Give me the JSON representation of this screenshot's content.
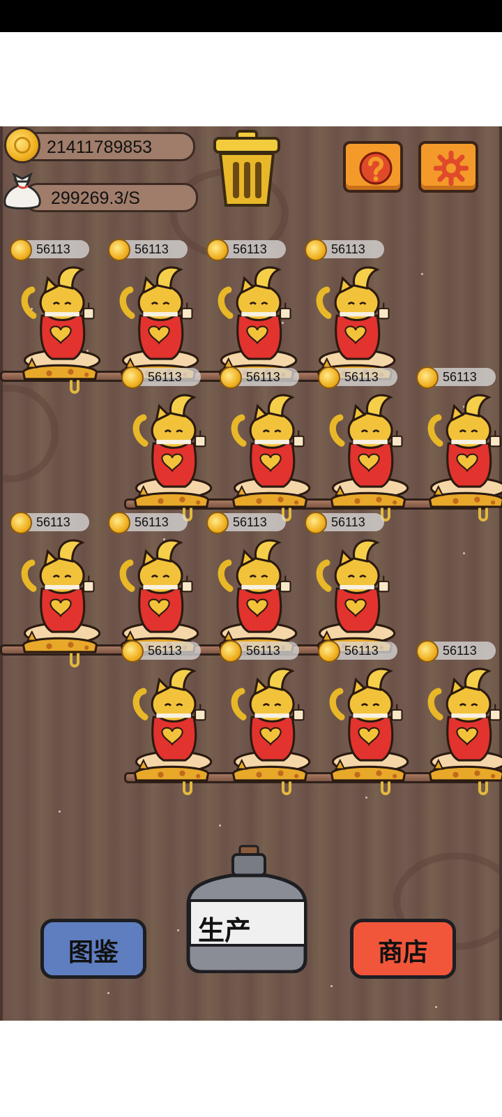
{
  "hud": {
    "coins": "21411789853",
    "rate": "299269.3/S"
  },
  "icons": {
    "coin": "coin-icon",
    "bag": "money-bag-icon",
    "trash": "trash-can-icon",
    "help": "question-mark-icon",
    "settings": "gear-icon"
  },
  "cats": [
    {
      "production": "56113"
    },
    {
      "production": "56113"
    },
    {
      "production": "56113"
    },
    {
      "production": "56113"
    },
    {
      "production": "56113"
    },
    {
      "production": "56113"
    },
    {
      "production": "56113"
    },
    {
      "production": "56113"
    },
    {
      "production": "56113"
    },
    {
      "production": "56113"
    },
    {
      "production": "56113"
    },
    {
      "production": "56113"
    },
    {
      "production": "56113"
    },
    {
      "production": "56113"
    },
    {
      "production": "56113"
    },
    {
      "production": "56113"
    }
  ],
  "nav": {
    "catalog_label": "图鉴",
    "produce_label": "生产",
    "shop_label": "商店"
  },
  "colors": {
    "catalog_button": "#5f7ec0",
    "shop_button": "#f2563a",
    "help_button": "#f39a2a"
  }
}
